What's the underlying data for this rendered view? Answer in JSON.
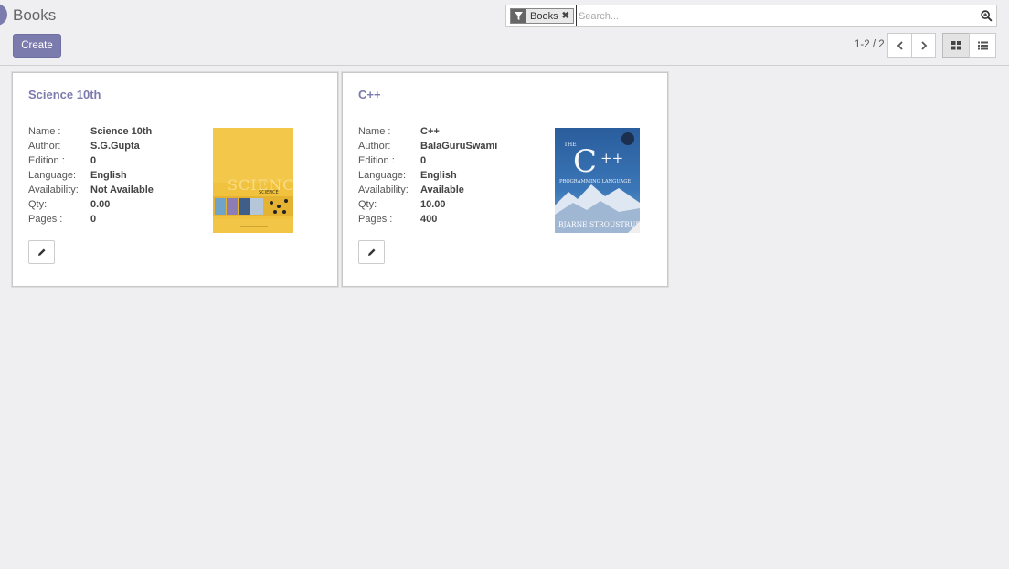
{
  "page": {
    "title": "Books"
  },
  "toolbar": {
    "create_label": "Create"
  },
  "search": {
    "facet_label": "Books",
    "facet_icon": "filter-icon",
    "placeholder": "Search...",
    "value": ""
  },
  "pager": {
    "text": "1-2 / 2"
  },
  "colors": {
    "accent": "#7c7bad",
    "background": "#efeef0"
  },
  "books": [
    {
      "title": "Science 10th",
      "fields": [
        {
          "label": "Name :",
          "value": "Science 10th"
        },
        {
          "label": "Author:",
          "value": "S.G.Gupta"
        },
        {
          "label": "Edition :",
          "value": "0"
        },
        {
          "label": "Language:",
          "value": "English"
        },
        {
          "label": "Availability:",
          "value": "Not Available"
        },
        {
          "label": "Qty:",
          "value": "0.00"
        },
        {
          "label": "Pages :",
          "value": "0"
        }
      ],
      "cover_text": [
        "SCIENCE",
        "SCIENCE"
      ]
    },
    {
      "title": "C++",
      "fields": [
        {
          "label": "Name :",
          "value": "C++"
        },
        {
          "label": "Author:",
          "value": "BalaGuruSwami"
        },
        {
          "label": "Edition :",
          "value": "0"
        },
        {
          "label": "Language:",
          "value": "English"
        },
        {
          "label": "Availability:",
          "value": "Available"
        },
        {
          "label": "Qty:",
          "value": "10.00"
        },
        {
          "label": "Pages :",
          "value": "400"
        }
      ],
      "cover_text": [
        "THE",
        "C",
        "++",
        "PROGRAMMING LANGUAGE",
        "BJARNE STROUSTRUP"
      ]
    }
  ]
}
